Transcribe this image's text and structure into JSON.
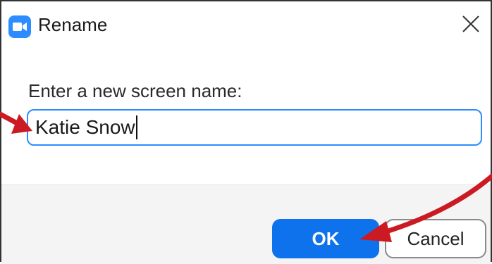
{
  "window": {
    "title": "Rename"
  },
  "icons": {
    "app": "zoom-camera-icon",
    "close": "close-icon"
  },
  "dialog": {
    "prompt": "Enter a new screen name:",
    "input_value": "Katie Snow"
  },
  "buttons": {
    "ok": "OK",
    "cancel": "Cancel"
  },
  "colors": {
    "accent": "#0E72ED",
    "app_icon": "#2D8CFF",
    "annotation_arrow": "#CC1A22"
  }
}
